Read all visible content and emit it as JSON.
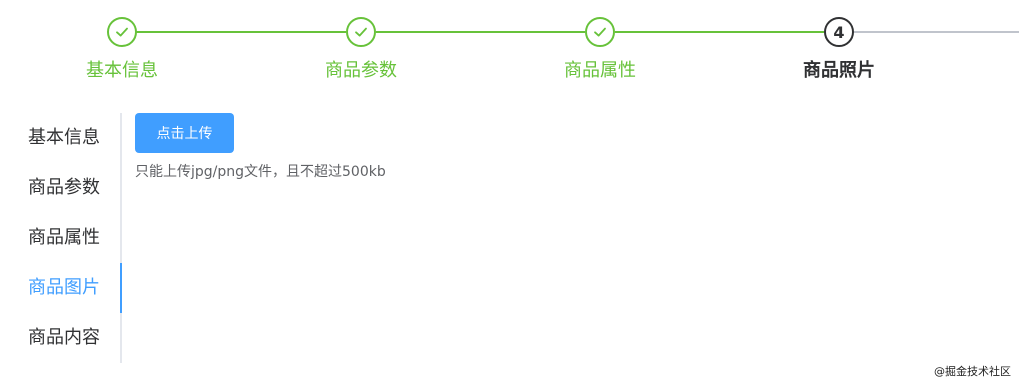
{
  "steps": [
    {
      "title": "基本信息",
      "status": "finish",
      "icon": "check-icon"
    },
    {
      "title": "商品参数",
      "status": "finish",
      "icon": "check-icon"
    },
    {
      "title": "商品属性",
      "status": "finish",
      "icon": "check-icon"
    },
    {
      "title": "商品照片",
      "status": "process",
      "number": "4"
    }
  ],
  "tabs": [
    {
      "label": "基本信息",
      "active": false
    },
    {
      "label": "商品参数",
      "active": false
    },
    {
      "label": "商品属性",
      "active": false
    },
    {
      "label": "商品图片",
      "active": true
    },
    {
      "label": "商品内容",
      "active": false
    }
  ],
  "upload": {
    "button_label": "点击上传",
    "tip": "只能上传jpg/png文件，且不超过500kb"
  },
  "watermark": "@掘金技术社区",
  "colors": {
    "success": "#67c23a",
    "primary": "#409eff",
    "text_primary": "#303133",
    "text_regular": "#606266",
    "border": "#e4e7ed",
    "pending_line": "#c0c4cc"
  }
}
